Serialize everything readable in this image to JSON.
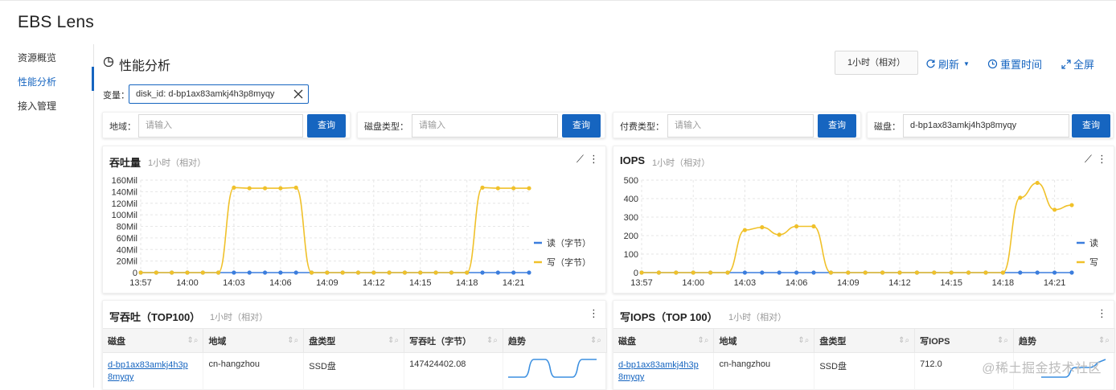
{
  "app": {
    "title": "EBS Lens"
  },
  "sidebar": {
    "items": [
      {
        "label": "资源概览"
      },
      {
        "label": "性能分析"
      },
      {
        "label": "接入管理"
      }
    ]
  },
  "header": {
    "title": "性能分析",
    "time_range": "1小时（相对）",
    "refresh": "刷新",
    "reset_time": "重置时间",
    "fullscreen": "全屏"
  },
  "variables": {
    "label": "变量：",
    "chip": "disk_id: d-bp1ax83amkj4h3p8myqy"
  },
  "filters": [
    {
      "label": "地域：",
      "placeholder": "请输入",
      "value": "",
      "button": "查询"
    },
    {
      "label": "磁盘类型：",
      "placeholder": "请输入",
      "value": "",
      "button": "查询"
    },
    {
      "label": "付费类型：",
      "placeholder": "请输入",
      "value": "",
      "button": "查询"
    },
    {
      "label": "磁盘：",
      "placeholder": "",
      "value": "d-bp1ax83amkj4h3p8myqy",
      "button": "查询"
    }
  ],
  "charts": {
    "throughput": {
      "title": "吞吐量",
      "subtitle": "1小时（相对）"
    },
    "iops": {
      "title": "IOPS",
      "subtitle": "1小时（相对）"
    }
  },
  "colors": {
    "read": "#3b7ddd",
    "write": "#f0c12a",
    "accent": "#1665c0"
  },
  "chart_data": [
    {
      "type": "line",
      "title": "吞吐量",
      "x": [
        "13:57",
        "13:58",
        "13:59",
        "14:00",
        "14:01",
        "14:02",
        "14:03",
        "14:04",
        "14:05",
        "14:06",
        "14:07",
        "14:08",
        "14:09",
        "14:10",
        "14:11",
        "14:12",
        "14:13",
        "14:14",
        "14:15",
        "14:16",
        "14:17",
        "14:18",
        "14:19",
        "14:20",
        "14:21",
        "14:22"
      ],
      "xticks": [
        "13:57",
        "14:00",
        "14:03",
        "14:06",
        "14:09",
        "14:12",
        "14:15",
        "14:18",
        "14:21"
      ],
      "yticks": [
        "0",
        "20Mil",
        "40Mil",
        "60Mil",
        "80Mil",
        "100Mil",
        "120Mil",
        "140Mil",
        "160Mil"
      ],
      "ylim": [
        0,
        160000000
      ],
      "series": [
        {
          "name": "读（字节）",
          "values": [
            0,
            0,
            0,
            0,
            0,
            0,
            0,
            0,
            0,
            0,
            0,
            0,
            0,
            0,
            0,
            0,
            0,
            0,
            0,
            0,
            0,
            0,
            0,
            0,
            0,
            0
          ]
        },
        {
          "name": "写（字节）",
          "values": [
            0,
            0,
            0,
            0,
            0,
            0,
            147000000,
            146000000,
            146000000,
            146000000,
            147000000,
            0,
            0,
            0,
            0,
            0,
            0,
            0,
            0,
            0,
            0,
            0,
            147000000,
            146000000,
            146000000,
            146000000
          ]
        }
      ],
      "legend": "right"
    },
    {
      "type": "line",
      "title": "IOPS",
      "x": [
        "13:57",
        "13:58",
        "13:59",
        "14:00",
        "14:01",
        "14:02",
        "14:03",
        "14:04",
        "14:05",
        "14:06",
        "14:07",
        "14:08",
        "14:09",
        "14:10",
        "14:11",
        "14:12",
        "14:13",
        "14:14",
        "14:15",
        "14:16",
        "14:17",
        "14:18",
        "14:19",
        "14:20",
        "14:21",
        "14:22"
      ],
      "xticks": [
        "13:57",
        "14:00",
        "14:03",
        "14:06",
        "14:09",
        "14:12",
        "14:15",
        "14:18",
        "14:21"
      ],
      "yticks": [
        "0",
        "100",
        "200",
        "300",
        "400",
        "500"
      ],
      "ylim": [
        0,
        500
      ],
      "series": [
        {
          "name": "读",
          "values": [
            0,
            0,
            0,
            0,
            0,
            0,
            0,
            0,
            0,
            0,
            0,
            0,
            0,
            0,
            0,
            0,
            0,
            0,
            0,
            0,
            0,
            0,
            0,
            0,
            0,
            0
          ]
        },
        {
          "name": "写",
          "values": [
            0,
            0,
            0,
            0,
            0,
            0,
            230,
            245,
            205,
            250,
            250,
            0,
            0,
            0,
            0,
            0,
            0,
            0,
            0,
            0,
            0,
            0,
            405,
            485,
            340,
            365
          ]
        }
      ],
      "legend": "right"
    }
  ],
  "tables": {
    "write_throughput": {
      "title": "写吞吐（TOP100）",
      "subtitle": "1小时（相对）",
      "columns": [
        "磁盘",
        "地域",
        "盘类型",
        "写吞吐（字节）",
        "趋势"
      ],
      "rows": [
        {
          "disk": "d-bp1ax83amkj4h3p8myqy",
          "disk_line1": "d-bp1ax83amkj4h3p",
          "disk_line2": "8myqy",
          "region": "cn-hangzhou",
          "type": "SSD盘",
          "value": "147424402.08"
        }
      ]
    },
    "write_iops": {
      "title": "写IOPS（TOP 100）",
      "subtitle": "1小时（相对）",
      "columns": [
        "磁盘",
        "地域",
        "盘类型",
        "写IOPS",
        "趋势"
      ],
      "rows": [
        {
          "disk": "d-bp1ax83amkj4h3p8myqy",
          "disk_line1": "d-bp1ax83amkj4h3p",
          "disk_line2": "8myqy",
          "region": "cn-hangzhou",
          "type": "SSD盘",
          "value": "712.0"
        }
      ]
    }
  },
  "watermark": "@稀土掘金技术社区"
}
